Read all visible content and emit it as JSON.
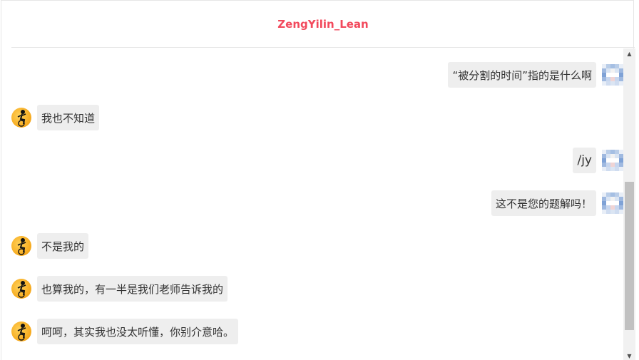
{
  "header": {
    "title": "ZengYilin_Lean"
  },
  "messages": [
    {
      "side": "right",
      "text": "“被分割的时间”指的是什么啊"
    },
    {
      "side": "left",
      "text": "我也不知道"
    },
    {
      "side": "right",
      "text": "/jy"
    },
    {
      "side": "right",
      "text": "这不是您的题解吗！"
    },
    {
      "side": "left",
      "text": "不是我的"
    },
    {
      "side": "left",
      "text": "也算我的，有一半是我们老师告诉我的"
    },
    {
      "side": "left",
      "text": "呵呵，其实我也没太听懂，你别介意哈。"
    }
  ],
  "icons": {
    "bot_avatar": "cartoon-figure-avatar-icon",
    "user_avatar": "pixelated-avatar-icon",
    "scroll_up": "▲",
    "scroll_down": "▼"
  },
  "colors": {
    "title": "#f2495c",
    "bubble": "#eeeeee",
    "border": "#e6e6e6"
  }
}
